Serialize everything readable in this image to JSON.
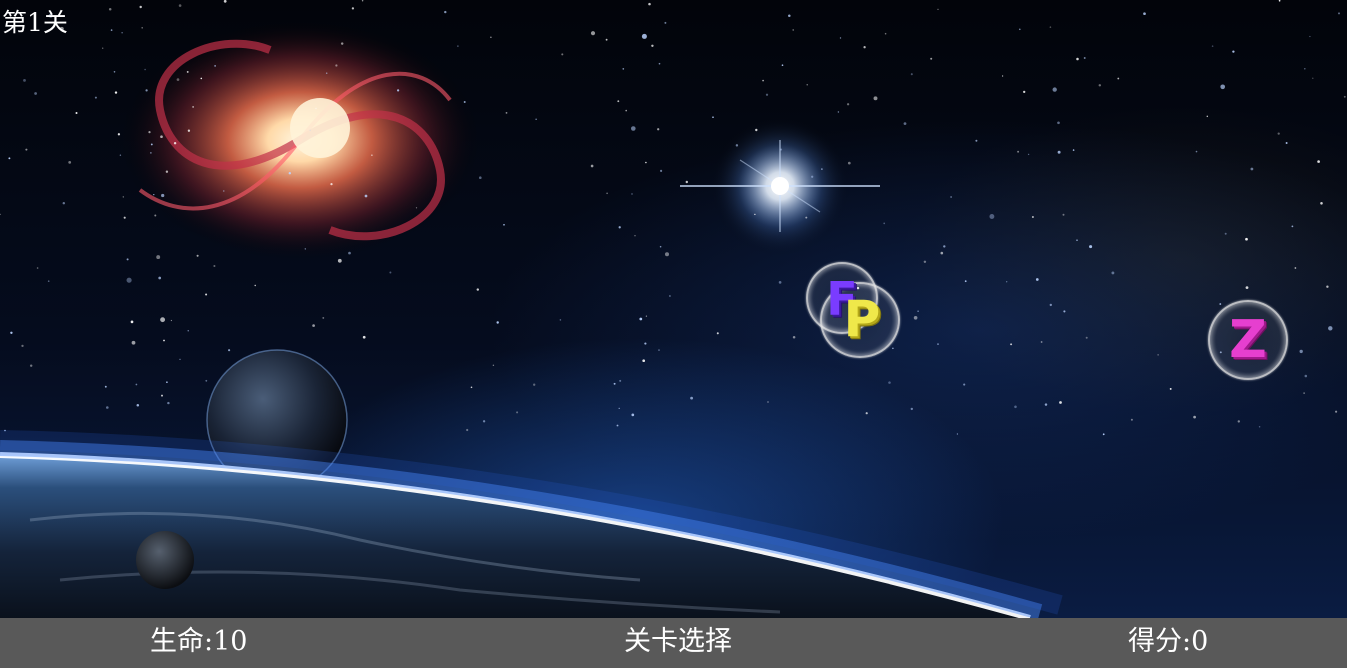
{
  "game": {
    "level_label": "第1关",
    "bubbles": [
      {
        "letters": [
          "F",
          "P"
        ],
        "colors": [
          "#7a3cff",
          "#e8e23a"
        ]
      },
      {
        "letters": [
          "Z"
        ],
        "colors": [
          "#e63fcf"
        ]
      }
    ]
  },
  "status_bar": {
    "lives_label": "生命:",
    "lives_value": "10",
    "level_select_label": "关卡选择",
    "score_label": "得分:",
    "score_value": "0",
    "background_color": "#595959",
    "text_color": "#ffffff"
  }
}
